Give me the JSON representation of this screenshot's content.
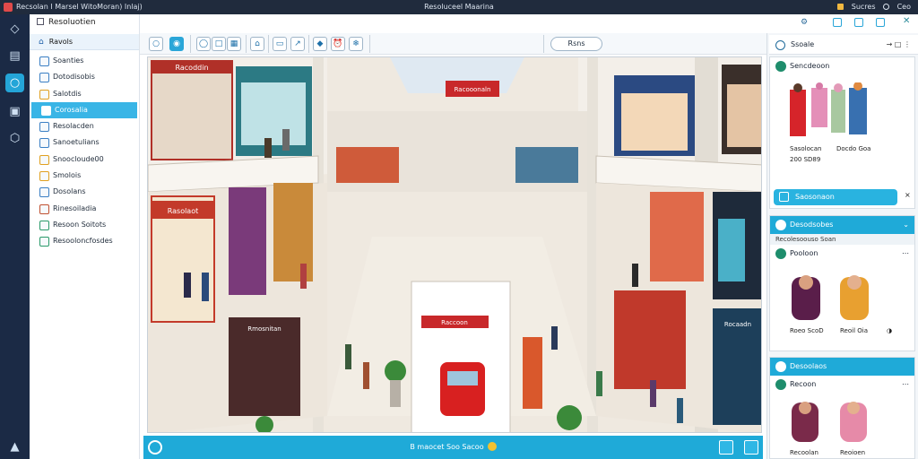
{
  "titlebar": {
    "left": "Recsolan I Marsel  WitoMoran)  Inlaj)",
    "center": "Resoluceel Maarina",
    "right_items": [
      "Sucres",
      "Ceo"
    ]
  },
  "rail": {
    "icons": [
      "diamond-icon",
      "book-icon",
      "chat-bubble-icon",
      "calendar-icon",
      "hexagon-icon",
      "network-icon"
    ]
  },
  "sidebar": {
    "header": "Resoluotien",
    "home_label": "Ravols",
    "items": [
      {
        "label": "Soanties",
        "icon_color": "#3b7fc4"
      },
      {
        "label": "Dotodisobis",
        "icon_color": "#3b7fc4"
      },
      {
        "label": "Salotdis",
        "icon_color": "#e0a020"
      },
      {
        "label": "Corosalia",
        "icon_color": "#ffffff"
      },
      {
        "label": "Resolacden",
        "icon_color": "#3b7fc4"
      },
      {
        "label": "Sanoetulians",
        "icon_color": "#3b7fc4"
      },
      {
        "label": "Snoocloude00",
        "icon_color": "#e0a020"
      },
      {
        "label": "Smolois",
        "icon_color": "#e0a020"
      },
      {
        "label": "Dosolans",
        "icon_color": "#3b7fc4"
      },
      {
        "label": "Rinesoiladia",
        "icon_color": "#c05030"
      },
      {
        "label": "Resoon Soitots",
        "icon_color": "#2a9a6a"
      },
      {
        "label": "Resooloncfosdes",
        "icon_color": "#2a9a6a"
      }
    ],
    "active_index": 3
  },
  "toolbar": {
    "tab_label": "Rsns"
  },
  "canvas": {
    "store_signs": [
      "Racoddin",
      "Rasolaot",
      "Rocaadn",
      "Rmosnitan"
    ],
    "center_sign": "Racooonaln",
    "kiosk_sign": "Raccoon"
  },
  "statusbar": {
    "text": "B  maocet  Soo  Sacoo"
  },
  "right_panel": {
    "search_label": "Ssoale",
    "card1": {
      "title": "Sencdeoon",
      "captions": [
        "Sasolocan",
        "Docdo Goa"
      ],
      "date": "200 SD89",
      "button": "Saosonaon"
    },
    "card2": {
      "title": "Desodsobes",
      "subtitle": "Recolesoouso Soan",
      "row_title": "Pooloon",
      "captions": [
        "Roeo ScoD",
        "Reoil Oia"
      ]
    },
    "card3": {
      "title": "Desoolaos",
      "row_title": "Recoon",
      "captions": [
        "Recoolan",
        "Reoioen"
      ]
    }
  },
  "colors": {
    "accent": "#1faad8",
    "rail": "#1b2a45",
    "titlebar": "#202b3d"
  }
}
